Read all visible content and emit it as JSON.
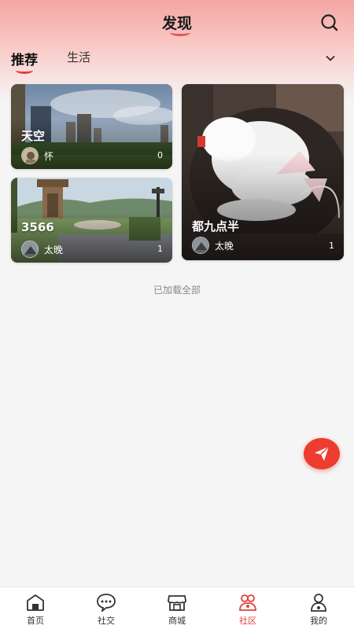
{
  "header": {
    "title": "发现"
  },
  "tabs": [
    {
      "label": "推荐",
      "active": true
    },
    {
      "label": "生活",
      "active": false
    }
  ],
  "posts": [
    {
      "title": "天空",
      "author": "怀",
      "count": "0"
    },
    {
      "title": "3566",
      "author": "太晚",
      "count": "1"
    },
    {
      "title": "都九点半",
      "author": "太晚",
      "count": "1"
    }
  ],
  "feed_end_text": "已加载全部",
  "bottom_nav": [
    {
      "label": "首页",
      "icon": "home-icon",
      "active": false
    },
    {
      "label": "社交",
      "icon": "chat-bubble-icon",
      "active": false
    },
    {
      "label": "商城",
      "icon": "store-icon",
      "active": false
    },
    {
      "label": "社区",
      "icon": "community-icon",
      "active": true
    },
    {
      "label": "我的",
      "icon": "user-icon",
      "active": false
    }
  ],
  "colors": {
    "accent": "#e0403a",
    "fab": "#ec3d2f"
  }
}
